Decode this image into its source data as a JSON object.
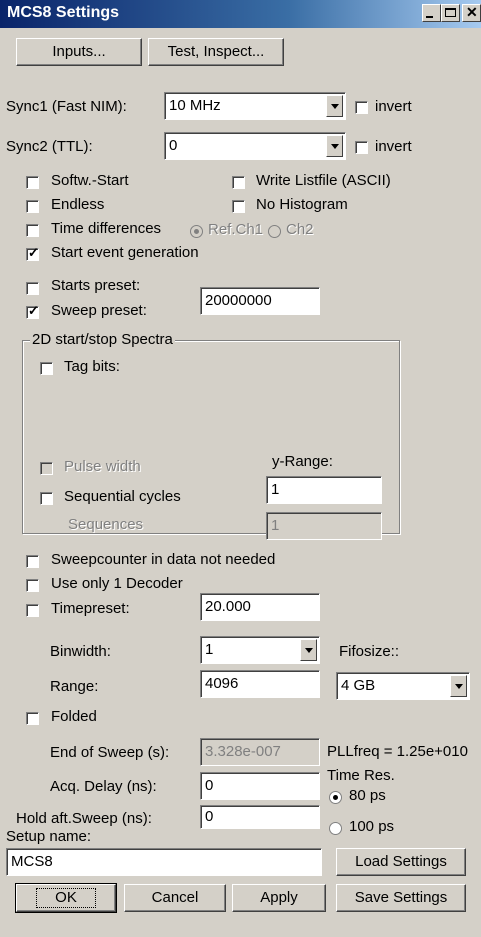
{
  "window": {
    "title": "MCS8 Settings"
  },
  "top_buttons": {
    "inputs": "Inputs...",
    "test": "Test, Inspect..."
  },
  "sync1": {
    "label": "Sync1 (Fast NIM):",
    "value": "10 MHz",
    "invert": "invert"
  },
  "sync2": {
    "label": "Sync2 (TTL):",
    "value": "0",
    "invert": "invert"
  },
  "options": {
    "softw_start": "Softw.-Start",
    "write_listfile": "Write Listfile (ASCII)",
    "endless": "Endless",
    "no_histogram": "No Histogram",
    "time_differences": "Time differences",
    "ref_ch1": "Ref.Ch1",
    "ch2": "Ch2",
    "start_event": "Start event generation",
    "starts_preset": "Starts preset:",
    "sweep_preset": "Sweep preset:",
    "sweep_preset_value": "20000000"
  },
  "spectra": {
    "title": "2D start/stop Spectra",
    "tag_bits": "Tag bits:",
    "pulse_width": "Pulse width",
    "y_range_label": "y-Range:",
    "y_range_value": "1",
    "sequential_cycles": "Sequential cycles",
    "sequences_label": "Sequences",
    "sequences_value": "1"
  },
  "lower": {
    "sweepcounter": "Sweepcounter in data not needed",
    "one_decoder": "Use only 1 Decoder",
    "timepreset": "Timepreset:",
    "timepreset_value": "20.000",
    "binwidth": "Binwidth:",
    "binwidth_value": "1",
    "fifosize": "Fifosize::",
    "range": "Range:",
    "range_value": "4096",
    "fifosize_value": "4 GB",
    "folded": "Folded",
    "end_of_sweep": "End of Sweep (s):",
    "end_of_sweep_value": "3.328e-007",
    "pllfreq": "PLLfreq = 1.25e+010",
    "acq_delay": "Acq. Delay (ns):",
    "acq_delay_value": "0",
    "time_res": "Time Res.",
    "res_80": "80 ps",
    "hold_after": "Hold aft.Sweep (ns):",
    "hold_after_value": "0",
    "res_100": "100 ps",
    "setup_name": "Setup name:",
    "setup_name_value": "MCS8"
  },
  "bottom_buttons": {
    "load": "Load Settings",
    "ok": "OK",
    "cancel": "Cancel",
    "apply": "Apply",
    "save": "Save Settings"
  }
}
